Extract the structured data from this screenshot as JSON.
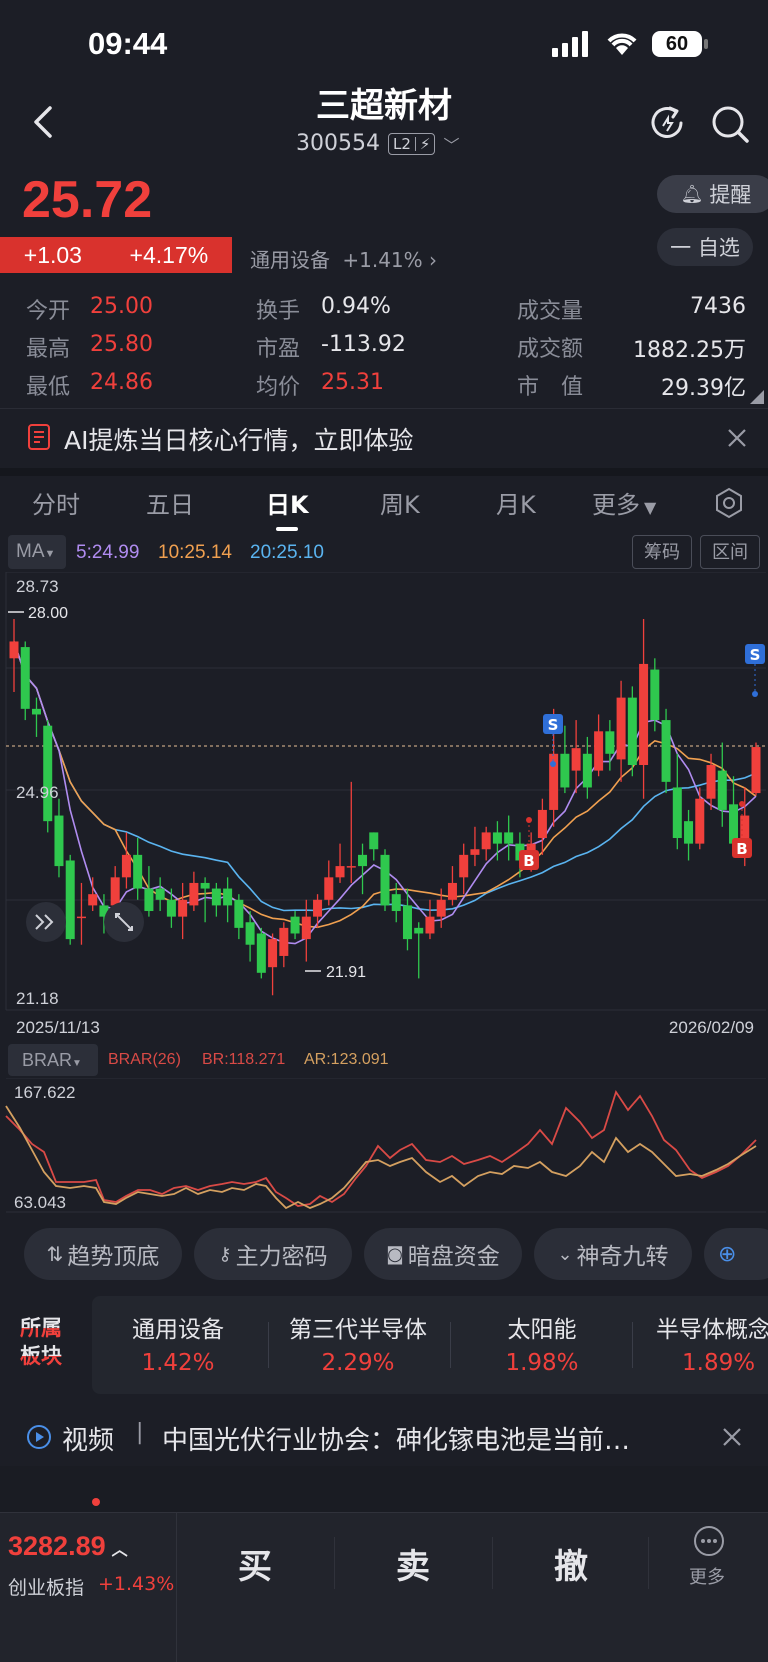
{
  "status": {
    "time": "09:44",
    "battery": "60"
  },
  "header": {
    "title": "三超新材",
    "code": "300554",
    "l2": "L2"
  },
  "quote": {
    "price": "25.72",
    "change": "+1.03",
    "change_pct": "+4.17%",
    "sector_name": "通用设备",
    "sector_pct": "+1.41%",
    "remind_label": "提醒",
    "watch_label": "一 自选"
  },
  "stats": {
    "open_label": "今开",
    "open": "25.00",
    "high_label": "最高",
    "high": "25.80",
    "low_label": "最低",
    "low": "24.86",
    "turnover_label": "换手",
    "turnover": "0.94%",
    "pe_label": "市盈",
    "pe": "-113.92",
    "avg_label": "均价",
    "avg": "25.31",
    "volume_label": "成交量",
    "volume": "7436",
    "amount_label": "成交额",
    "amount": "1882.25万",
    "mcap_label": "市　值",
    "mcap": "29.39亿"
  },
  "ai_banner": {
    "text": "AI提炼当日核心行情，立即体验"
  },
  "tabs": [
    "分时",
    "五日",
    "日K",
    "周K",
    "月K",
    "更多"
  ],
  "active_tab": "日K",
  "ma": {
    "label": "MA",
    "ma5": "5:24.99",
    "ma10": "10:25.14",
    "ma20": "20:25.10",
    "chip_btn": "筹码",
    "range_btn": "区间"
  },
  "colors": {
    "up": "#f0403c",
    "down": "#2fc84e",
    "ma5": "#b08cf0",
    "ma10": "#f0a050",
    "ma20": "#5ab4f0"
  },
  "axis": {
    "top": "28.73",
    "mark_high": "28.00",
    "mid": "24.96",
    "mark_low": "21.91",
    "bottom": "21.18",
    "date_start": "2025/11/13",
    "date_end": "2026/02/09"
  },
  "signals": {
    "buy": "B",
    "sell": "S"
  },
  "brar": {
    "label": "BRAR",
    "name": "BRAR(26)",
    "br": "BR:118.271",
    "ar": "AR:123.091",
    "top": "167.622",
    "bottom": "63.043"
  },
  "chips": [
    "趋势顶底",
    "主力密码",
    "暗盘资金",
    "神奇九转"
  ],
  "sectors_label": "所属\n板块",
  "sectors": [
    {
      "name": "通用设备",
      "pct": "1.42%"
    },
    {
      "name": "第三代半导体",
      "pct": "2.29%"
    },
    {
      "name": "太阳能",
      "pct": "1.98%"
    },
    {
      "name": "半导体概念",
      "pct": "1.89%"
    }
  ],
  "video": {
    "tag": "视频",
    "text": "中国光伏行业协会：砷化镓电池是当前…"
  },
  "bottom": {
    "index_value": "3282.89",
    "index_name": "创业板指",
    "index_pct": "+1.43%",
    "buy": "买",
    "sell": "卖",
    "cancel": "撤",
    "more": "更多"
  },
  "chart_data": {
    "type": "candlestick",
    "ylim": [
      21.18,
      28.73
    ],
    "x_start": "2025/11/13",
    "x_end": "2026/02/09",
    "candles": [
      [
        27.3,
        27.6,
        28.0,
        26.7
      ],
      [
        27.5,
        26.4,
        27.6,
        26.2
      ],
      [
        26.4,
        26.3,
        26.6,
        25.9
      ],
      [
        26.1,
        24.4,
        26.2,
        24.2
      ],
      [
        24.5,
        23.6,
        24.8,
        23.4
      ],
      [
        23.7,
        22.3,
        23.8,
        22.2
      ],
      [
        22.7,
        22.7,
        23.3,
        22.2
      ],
      [
        22.9,
        23.1,
        23.4,
        22.8
      ],
      [
        22.9,
        22.7,
        23.1,
        22.4
      ],
      [
        22.9,
        23.4,
        23.6,
        22.8
      ],
      [
        23.4,
        23.8,
        24.2,
        23.2
      ],
      [
        23.8,
        23.2,
        24.1,
        23.0
      ],
      [
        23.2,
        22.8,
        23.6,
        22.7
      ],
      [
        23.2,
        23.0,
        23.4,
        22.8
      ],
      [
        23.0,
        22.7,
        23.2,
        22.5
      ],
      [
        22.7,
        23.0,
        23.3,
        22.3
      ],
      [
        22.9,
        23.3,
        23.5,
        22.8
      ],
      [
        23.3,
        23.2,
        23.4,
        22.6
      ],
      [
        23.2,
        22.9,
        23.3,
        22.7
      ],
      [
        23.2,
        22.9,
        23.4,
        22.6
      ],
      [
        23.0,
        22.5,
        23.1,
        22.3
      ],
      [
        22.6,
        22.2,
        22.8,
        21.9
      ],
      [
        22.4,
        21.7,
        22.5,
        21.6
      ],
      [
        21.8,
        22.3,
        22.4,
        21.3
      ],
      [
        22.0,
        22.5,
        22.6,
        21.8
      ],
      [
        22.7,
        22.4,
        22.8,
        22.3
      ],
      [
        22.3,
        22.7,
        23.0,
        21.9
      ],
      [
        22.7,
        23.0,
        23.1,
        22.5
      ],
      [
        23.0,
        23.4,
        23.7,
        22.9
      ],
      [
        23.4,
        23.6,
        24.0,
        23.3
      ],
      [
        23.6,
        23.6,
        25.1,
        23.3
      ],
      [
        23.8,
        23.6,
        24.0,
        23.1
      ],
      [
        24.2,
        23.9,
        24.2,
        23.7
      ],
      [
        23.8,
        22.9,
        23.9,
        22.8
      ],
      [
        23.1,
        22.8,
        23.3,
        22.6
      ],
      [
        22.9,
        22.3,
        23.2,
        22.1
      ],
      [
        22.5,
        22.4,
        22.6,
        21.6
      ],
      [
        22.4,
        22.7,
        23.0,
        22.3
      ],
      [
        22.7,
        23.0,
        23.2,
        22.5
      ],
      [
        23.0,
        23.3,
        23.6,
        22.9
      ],
      [
        23.4,
        23.8,
        24.0,
        23.1
      ],
      [
        23.8,
        23.9,
        24.3,
        23.6
      ],
      [
        23.9,
        24.2,
        24.3,
        23.7
      ],
      [
        24.2,
        24.0,
        24.4,
        23.7
      ],
      [
        24.2,
        24.0,
        24.5,
        23.7
      ],
      [
        24.0,
        23.7,
        24.2,
        23.4
      ],
      [
        23.7,
        24.0,
        24.2,
        23.5
      ],
      [
        24.1,
        24.6,
        24.8,
        23.8
      ],
      [
        24.6,
        25.6,
        26.4,
        24.3
      ],
      [
        25.6,
        25.0,
        26.1,
        24.9
      ],
      [
        25.3,
        25.7,
        26.2,
        24.9
      ],
      [
        25.6,
        25.0,
        25.9,
        24.8
      ],
      [
        25.3,
        26.0,
        26.3,
        25.2
      ],
      [
        26.0,
        25.6,
        26.2,
        25.3
      ],
      [
        25.5,
        26.6,
        26.9,
        25.1
      ],
      [
        26.6,
        25.4,
        26.8,
        25.2
      ],
      [
        25.4,
        27.2,
        28.0,
        24.8
      ],
      [
        27.1,
        26.2,
        27.3,
        26.0
      ],
      [
        26.2,
        25.1,
        26.4,
        24.9
      ],
      [
        25.0,
        24.1,
        25.6,
        23.9
      ],
      [
        24.4,
        24.0,
        24.6,
        23.7
      ],
      [
        24.0,
        24.8,
        25.0,
        23.9
      ],
      [
        24.8,
        25.4,
        25.6,
        24.6
      ],
      [
        25.3,
        24.6,
        25.8,
        24.3
      ],
      [
        24.7,
        24.0,
        25.2,
        23.8
      ],
      [
        23.9,
        24.5,
        25.0,
        23.6
      ],
      [
        24.9,
        25.72,
        25.8,
        24.86
      ]
    ]
  }
}
